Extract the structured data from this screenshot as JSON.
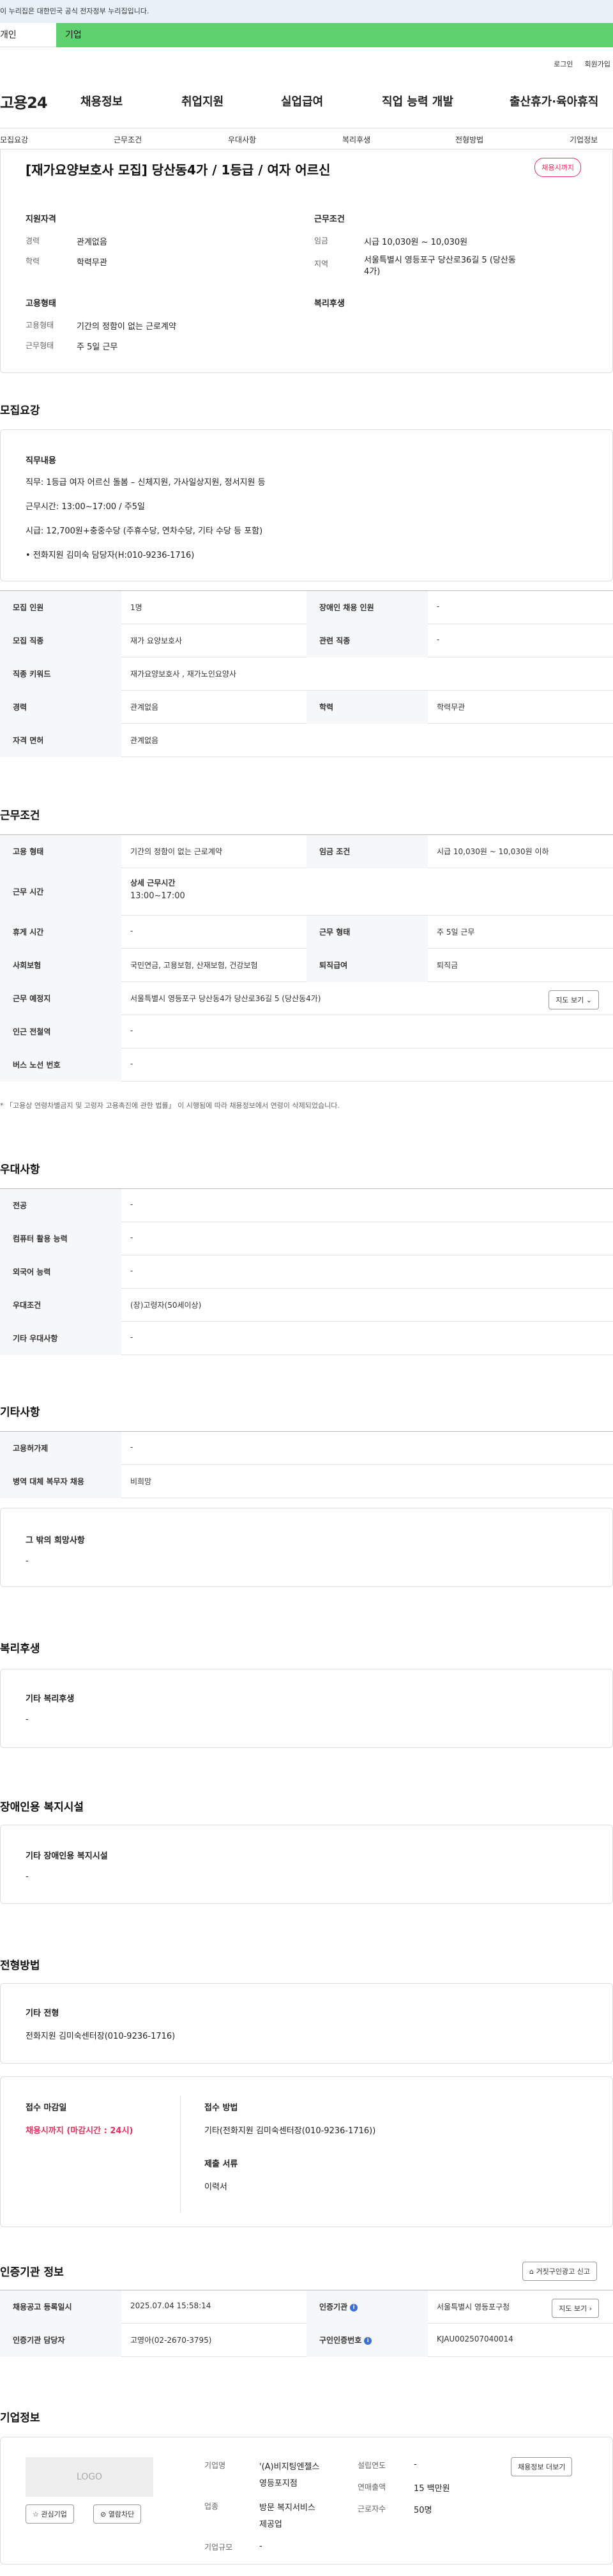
{
  "banner": {
    "text": "이 누리집은 대한민국 공식 전자정부 누리집입니다."
  },
  "top_tabs": {
    "personal": "개인",
    "company": "기업"
  },
  "util": {
    "login": "로그인",
    "join": "회원가입"
  },
  "gnb": {
    "logo": "고용24",
    "items": [
      "채용정보",
      "취업지원",
      "실업급여",
      "직업 능력 개발",
      "출산휴가·육아휴직"
    ]
  },
  "subnav": [
    "모집요강",
    "근무조건",
    "우대사항",
    "복리후생",
    "전형방법",
    "기업정보"
  ],
  "job": {
    "title": "[재가요양보호사 모집] 당산동4가 / 1등급 / 여자 어르신",
    "badge": "채용시까지",
    "qual_h": "지원자격",
    "career_l": "경력",
    "career_v": "관계없음",
    "edu_l": "학력",
    "edu_v": "학력무관",
    "cond_h": "근무조건",
    "wage_l": "임금",
    "wage_v": "시급 10,030원 ~ 10,030원",
    "region_l": "지역",
    "region_v1": "서울특별시 영등포구 당산로36길 5 (당산동",
    "region_v2": "4가)",
    "emp_h": "고용형태",
    "emp_type_l": "고용형태",
    "emp_type_v": "기간의 정함이 없는 근로계약",
    "work_type_l": "근무형태",
    "work_type_v": "주 5일 근무",
    "welfare_h": "복리후생"
  },
  "recruit": {
    "heading": "모집요강",
    "duty_h": "직무내용",
    "duty_lines": [
      "직무: 1등급 여자 어르신 돌봄 – 신체지원, 가사일상지원, 정서지원 등",
      "근무시간: 13:00~17:00 / 주5일",
      "시급: 12,700원+충중수당 (주휴수당, 연차수당, 기타 수당 등 포함)",
      "• 전화지원 김미숙 담당자(H:010-9236-1716)"
    ],
    "rows": [
      [
        "모집 인원",
        "1명",
        "장애인 채용 인원",
        "-"
      ],
      [
        "모집 직종",
        "재가 요양보호사",
        "관련 직종",
        "-"
      ],
      [
        "직종 키워드",
        "재가요양보호사 , 재가노인요양사",
        "",
        ""
      ],
      [
        "경력",
        "관계없음",
        "학력",
        "학력무관"
      ],
      [
        "자격 면허",
        "관계없음",
        "",
        ""
      ]
    ]
  },
  "conditions": {
    "heading": "근무조건",
    "rows": [
      [
        "고용 형태",
        "기간의 정함이 없는 근로계약",
        "임금 조건",
        "시급 10,030원 ~ 10,030원 이하"
      ],
      [
        "근무 시간",
        "",
        "근무 형태",
        ""
      ],
      [
        "휴게 시간",
        "-",
        "근무 형태",
        "주 5일 근무"
      ],
      [
        "사회보험",
        "국민연금, 고용보험, 산재보험, 건강보험",
        "퇴직급여",
        "퇴직금"
      ],
      [
        "근무 예정지",
        "서울특별시 영등포구 당산동4가 당산로36길 5 (당산동4가)",
        "",
        ""
      ],
      [
        "인근 전철역",
        "-",
        "",
        ""
      ],
      [
        "버스 노선 번호",
        "-",
        "",
        ""
      ]
    ],
    "hours_title": "상세 근무시간",
    "hours_value": "13:00~17:00",
    "map_btn": "지도 보기",
    "note": "* 「고용상 연령차별금지 및 고령자 고용촉진에 관한 법률」 이 시행됨에 따라 채용정보에서 연령이 삭제되었습니다."
  },
  "preference": {
    "heading": "우대사항",
    "rows": [
      [
        "전공",
        "-"
      ],
      [
        "컴퓨터 활용 능력",
        "-"
      ],
      [
        "외국어 능력",
        "-"
      ],
      [
        "우대조건",
        "(장)고령자(50세이상)"
      ],
      [
        "기타 우대사항",
        "-"
      ]
    ]
  },
  "etc": {
    "heading": "기타사항",
    "rows": [
      [
        "고용허가제",
        "-"
      ],
      [
        "병역 대체 복무자 채용",
        "비희망"
      ]
    ],
    "wish_h": "그 밖의 희망사항",
    "wish_v": "-"
  },
  "welfare": {
    "heading": "복리후생",
    "sub": "기타 복리후생",
    "val": "-"
  },
  "disability": {
    "heading": "장애인용 복지시설",
    "sub": "기타 장애인용 복지시설",
    "val": "-"
  },
  "selection": {
    "heading": "전형방법",
    "other_h": "기타 전형",
    "other_v": "전화지원 김미숙센터장(010-9236-1716)",
    "deadline_h": "접수 마감일",
    "deadline_v": "채용시까지 (마감시간 : 24시)",
    "method_h": "접수 방법",
    "method_v": "기타(전화지원 김미숙센터장(010-9236-1716))",
    "docs_h": "제출 서류",
    "docs_v": "이력서"
  },
  "certification": {
    "heading": "인증기관 정보",
    "report_btn": "거짓구인광고 신고",
    "rows": [
      [
        "채용공고 등록일시",
        "2025.07.04 15:58:14",
        "인증기관",
        "서울특별시 영등포구청"
      ],
      [
        "인증기관 담당자",
        "고영아(02-2670-3795)",
        "구인인증번호",
        "KJAU002507040014"
      ]
    ],
    "map_btn": "지도 보기"
  },
  "company": {
    "heading": "기업정보",
    "logo": "LOGO",
    "fav_btn": "관심기업",
    "block_btn": "열람차단",
    "name_l": "기업명",
    "name_v1": "'(A)비지팅엔젤스",
    "name_v2": "영등포지점",
    "industry_l": "업종",
    "industry_v1": "방문 복지서비스",
    "industry_v2": "제공업",
    "scale_l": "기업규모",
    "scale_v": "-",
    "founded_l": "설립연도",
    "founded_v": "-",
    "sales_l": "연매출액",
    "sales_v": "15 백만원",
    "staff_l": "근로자수",
    "staff_v": "50명",
    "more_btn": "채용정보 더보기"
  }
}
